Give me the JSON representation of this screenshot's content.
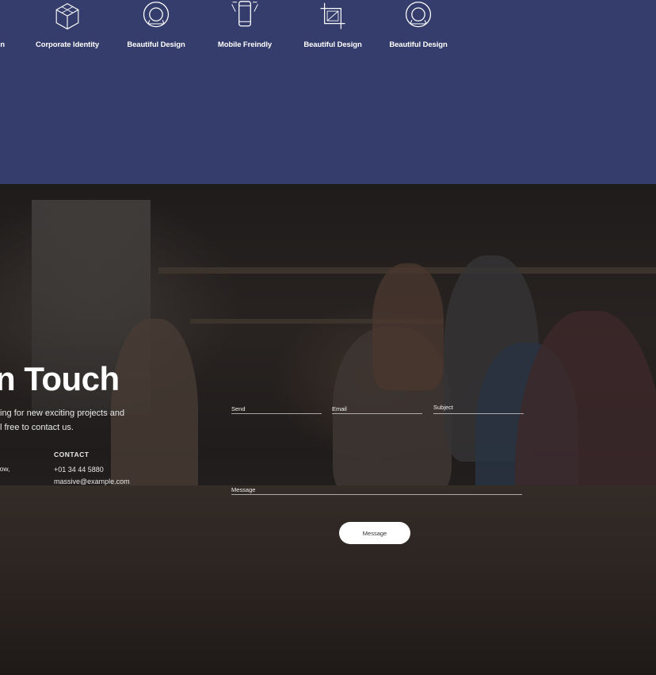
{
  "features": {
    "items": [
      {
        "label": "n",
        "icon": "bulb-icon"
      },
      {
        "label": "Corporate Identity",
        "icon": "cube-icon"
      },
      {
        "label": "Beautiful Design",
        "icon": "lifebuoy-icon"
      },
      {
        "label": "Mobile Freindly",
        "icon": "mobile-icon"
      },
      {
        "label": "Beautiful Design",
        "icon": "crop-icon"
      },
      {
        "label": "Beautiful Design",
        "icon": "lifebuoy-icon"
      }
    ]
  },
  "contact": {
    "heading": "n Touch",
    "intro_line1": "ing for new exciting projects and",
    "intro_line2": "l free to contact us.",
    "address_partial": "lasgow,",
    "contact_title": "CONTACT",
    "phone": "+01  34 44 5880",
    "email": "massive@example.com"
  },
  "form": {
    "send_placeholder": "Send",
    "email_placeholder": "Email",
    "subject_placeholder": "Subject",
    "message_placeholder": "Message",
    "submit_label": "Message"
  },
  "colors": {
    "features_bg": "#343d6b",
    "text": "#ffffff",
    "button_bg": "#ffffff"
  }
}
